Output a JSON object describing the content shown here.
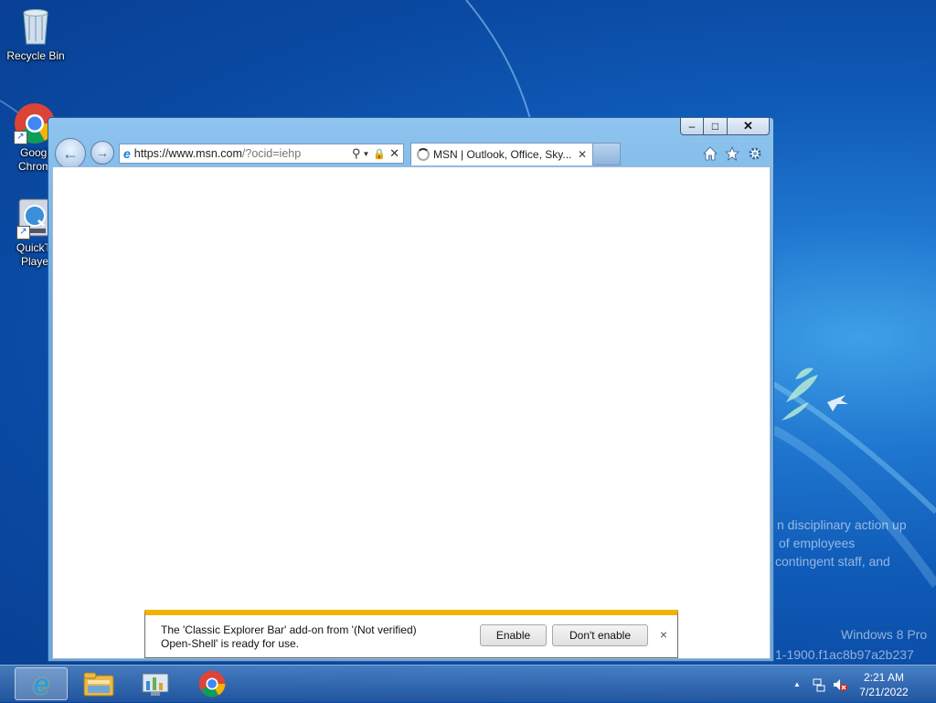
{
  "desktop": {
    "icons": [
      {
        "label": "Recycle Bin",
        "icon": "recycle-bin-icon"
      },
      {
        "label": "Googl Chrom",
        "line1": "Googl",
        "line2": "Chrom",
        "icon": "chrome-icon"
      },
      {
        "label": "QuickTi Playe",
        "line1": "QuickTi",
        "line2": "Playe",
        "icon": "quicktime-icon"
      }
    ],
    "watermark": {
      "line1": "n disciplinary action up",
      "line2": "of employees",
      "line3": "contingent staff, and",
      "line4": "Windows 8 Pro",
      "line5": "1-1900.f1ac8b97a2b237"
    }
  },
  "browser": {
    "address_url_host": "https://www.msn.com",
    "address_url_path": "/?ocid=iehp",
    "tab_title": "MSN | Outlook, Office, Sky...",
    "caption": {
      "minimize": "–",
      "maximize": "□",
      "close": "✕"
    }
  },
  "notification": {
    "line1": "The 'Classic Explorer Bar' add-on from '(Not verified)",
    "line2": "Open-Shell' is ready for use.",
    "enable_label": "Enable",
    "dont_enable_label": "Don't enable",
    "close_label": "×",
    "accent": "#f0b400"
  },
  "taskbar": {
    "items": [
      "internet-explorer-icon",
      "file-explorer-icon",
      "control-panel-icon",
      "chrome-icon"
    ],
    "clock_time": "2:21 AM",
    "clock_date": "7/21/2022",
    "tray_arrow": "▲"
  }
}
